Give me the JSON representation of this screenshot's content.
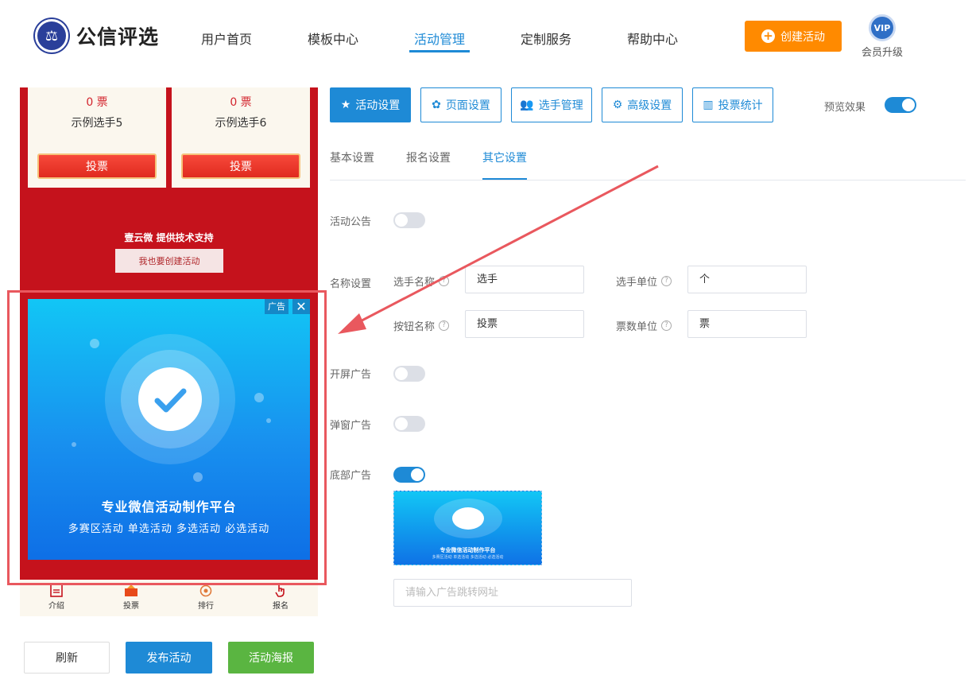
{
  "brand": {
    "name": "公信评选"
  },
  "nav": [
    "用户首页",
    "模板中心",
    "活动管理",
    "定制服务",
    "帮助中心"
  ],
  "header": {
    "create_label": "创建活动",
    "vip_badge": "VIP",
    "vip_label": "会员升级"
  },
  "preview": {
    "cards": [
      {
        "votes": "0 票",
        "name": "示例选手5",
        "vote_btn": "投票"
      },
      {
        "votes": "0 票",
        "name": "示例选手6",
        "vote_btn": "投票"
      }
    ],
    "tech_support": "壹云微 提供技术支持",
    "me_create": "我也要创建活动",
    "ad": {
      "tag": "广告",
      "close": "✕",
      "title": "专业微信活动制作平台",
      "subtitle": "多赛区活动  单选活动  多选活动  必选活动"
    },
    "tabbar": [
      "介绍",
      "投票",
      "排行",
      "报名"
    ]
  },
  "actions": {
    "refresh": "刷新",
    "publish": "发布活动",
    "poster": "活动海报"
  },
  "toolbar": {
    "buttons": [
      "活动设置",
      "页面设置",
      "选手管理",
      "高级设置",
      "投票统计"
    ],
    "preview_label": "预览效果"
  },
  "subtabs": [
    "基本设置",
    "报名设置",
    "其它设置"
  ],
  "form": {
    "activity_notice": "活动公告",
    "name_settings": "名称设置",
    "contestant_name_label": "选手名称",
    "contestant_name_value": "选手",
    "contestant_unit_label": "选手单位",
    "contestant_unit_value": "个",
    "button_name_label": "按钮名称",
    "button_name_value": "投票",
    "vote_unit_label": "票数单位",
    "vote_unit_value": "票",
    "splash_ad": "开屏广告",
    "popup_ad": "弹窗广告",
    "bottom_ad": "底部广告",
    "ad_url_placeholder": "请输入广告跳转网址",
    "thumb_title": "专业微信活动制作平台",
    "thumb_sub": "多赛区活动  单选活动  多选活动  必选活动"
  },
  "toggles": {
    "preview": true,
    "activity_notice": false,
    "splash_ad": false,
    "popup_ad": false,
    "bottom_ad": true
  },
  "colors": {
    "accent": "#1e8ad6",
    "orange": "#ff8a00",
    "green": "#5ab541",
    "red": "#c5121c",
    "annotation": "#e9585e"
  }
}
